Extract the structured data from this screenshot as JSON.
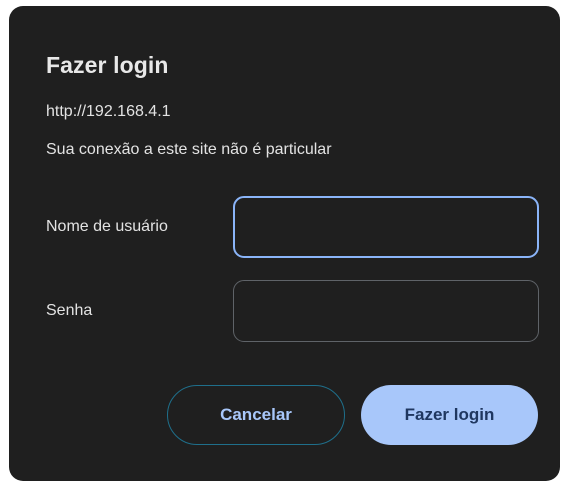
{
  "dialog": {
    "title": "Fazer login",
    "origin": "http://192.168.4.1",
    "notice": "Sua conexão a este site não é particular",
    "fields": {
      "username_label": "Nome de usuário",
      "username_value": "",
      "password_label": "Senha",
      "password_value": ""
    },
    "buttons": {
      "cancel_label": "Cancelar",
      "login_label": "Fazer login"
    }
  },
  "colors": {
    "dialog_background": "#1f1f1f",
    "focus_ring": "#8ab4f8",
    "primary_button": "#a8c7fa",
    "primary_button_text": "#1f3760",
    "secondary_button_text": "#a8c7fa"
  }
}
